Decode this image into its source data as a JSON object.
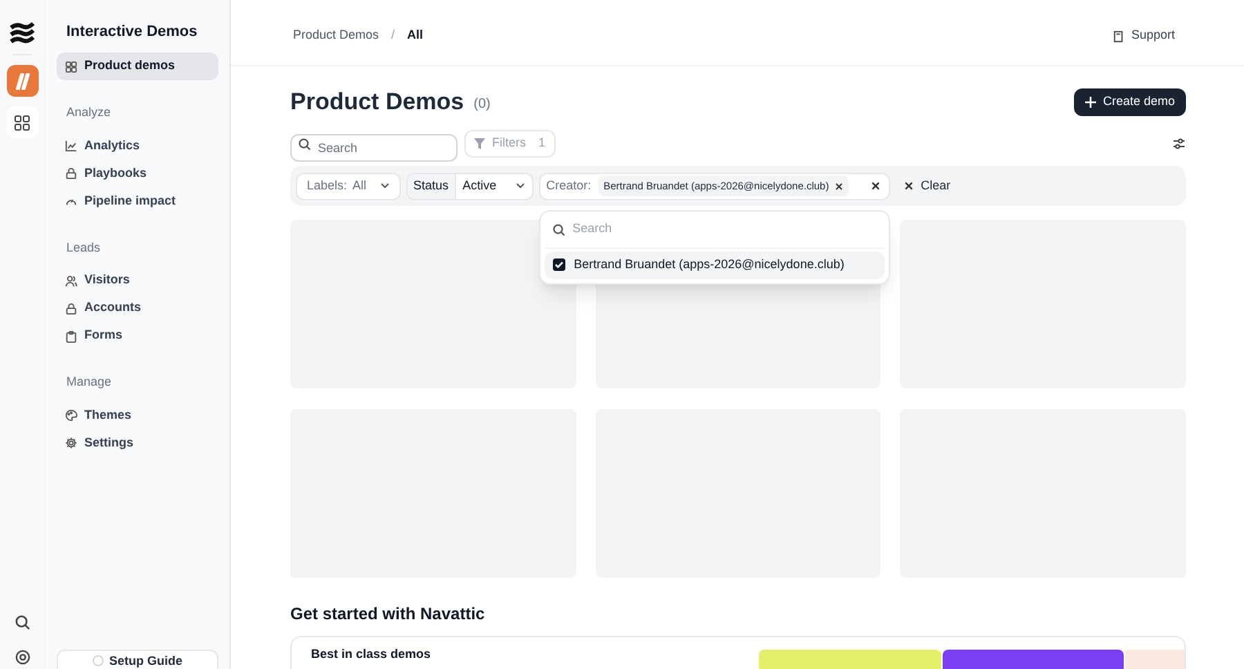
{
  "sidebar": {
    "title": "Interactive Demos",
    "sections": [
      {
        "items": [
          {
            "label": "Product demos",
            "selected": true
          }
        ]
      },
      {
        "heading": "Analyze",
        "items": [
          {
            "label": "Analytics",
            "selected": false
          },
          {
            "label": "Playbooks",
            "selected": false
          },
          {
            "label": "Pipeline impact",
            "selected": false
          }
        ]
      },
      {
        "heading": "Leads",
        "items": [
          {
            "label": "Visitors",
            "selected": false
          },
          {
            "label": "Accounts",
            "selected": false
          },
          {
            "label": "Forms",
            "selected": false
          }
        ]
      },
      {
        "heading": "Manage",
        "items": [
          {
            "label": "Themes",
            "selected": false
          },
          {
            "label": "Settings",
            "selected": false
          }
        ]
      }
    ],
    "setup_button": "Setup Guide"
  },
  "breadcrumb": [
    "Product Demos",
    "/",
    "All"
  ],
  "support": "Support",
  "page": {
    "title": "Product Demos",
    "count": "(0)",
    "create_button": "Create demo"
  },
  "search": {
    "placeholder": "Search"
  },
  "filters_button": {
    "label": "Filters",
    "count": "1",
    "disabled": true
  },
  "filter_bar": {
    "labels": {
      "label": "Labels:",
      "value": "All"
    },
    "status": {
      "label": "Status",
      "value": "Active"
    },
    "creator": {
      "label": "Creator:",
      "chip": "Bertrand Bruandet (apps-2026@nicelydone.club)"
    },
    "clear": "Clear"
  },
  "dropdown": {
    "placeholder": "Search",
    "options": [
      {
        "label": "Bertrand Bruandet (apps-2026@nicelydone.club)",
        "checked": true
      }
    ]
  },
  "get_started": {
    "heading": "Get started with Navattic",
    "card_title": "Best in class demos"
  }
}
